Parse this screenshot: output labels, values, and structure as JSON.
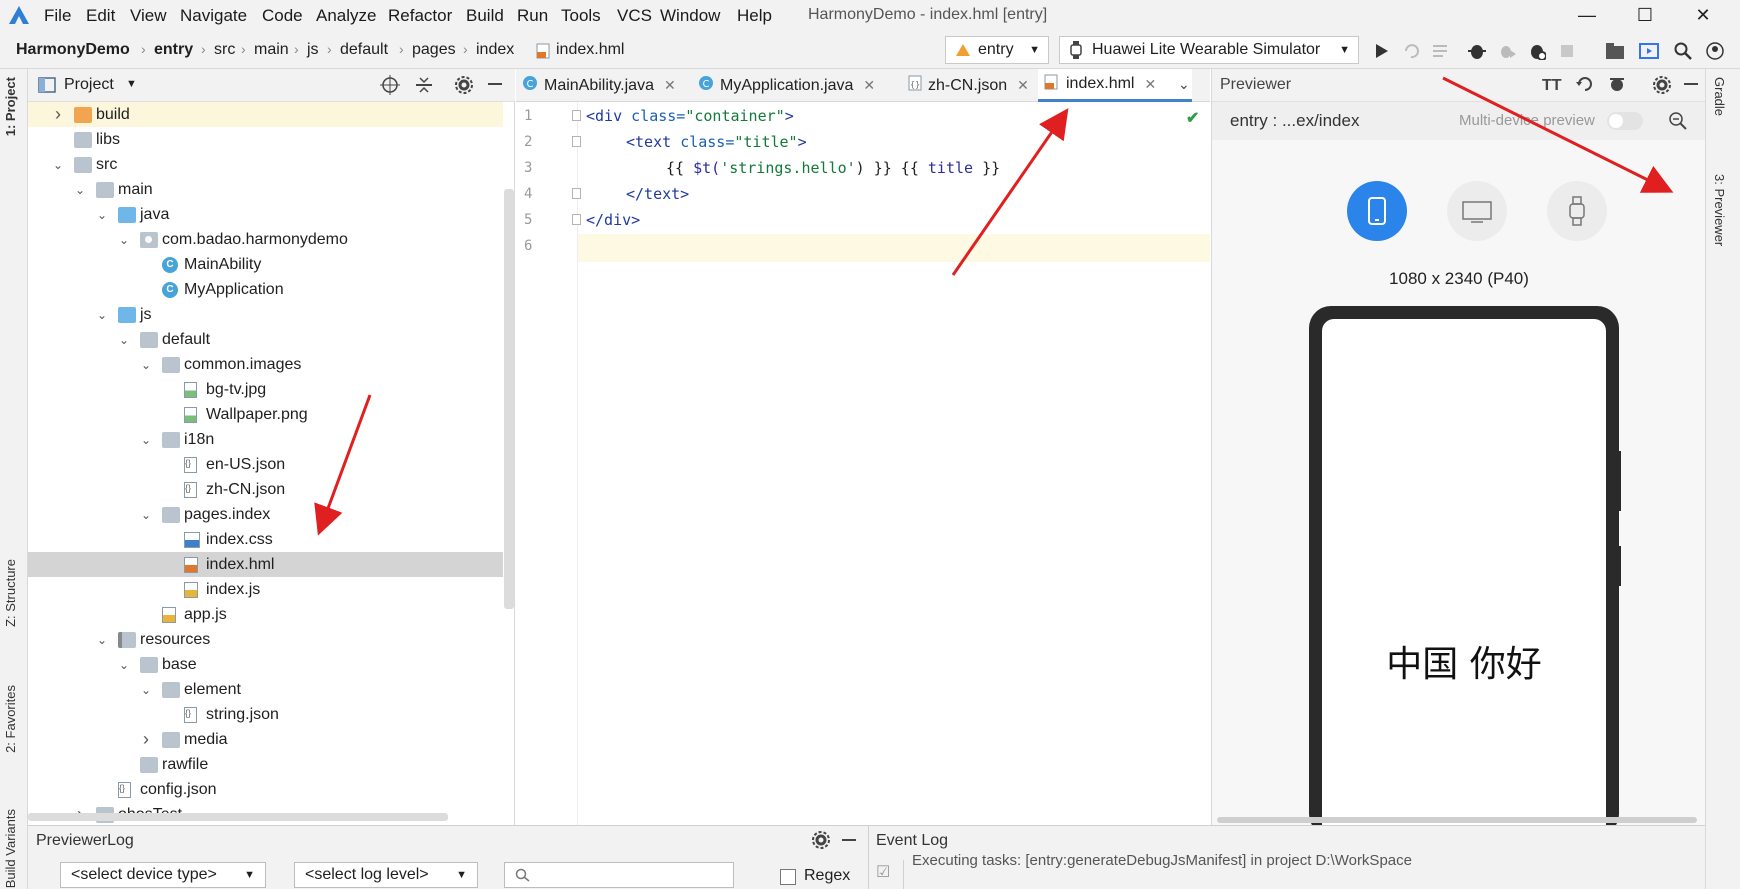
{
  "window": {
    "title": "HarmonyDemo - index.hml [entry]",
    "menu": [
      "File",
      "Edit",
      "View",
      "Navigate",
      "Code",
      "Analyze",
      "Refactor",
      "Build",
      "Run",
      "Tools",
      "VCS",
      "Window",
      "Help"
    ]
  },
  "breadcrumb": [
    "HarmonyDemo",
    "entry",
    "src",
    "main",
    "js",
    "default",
    "pages",
    "index",
    "index.hml"
  ],
  "toolbar": {
    "module": "entry",
    "device": "Huawei Lite Wearable Simulator"
  },
  "left_stripe": {
    "project": "1: Project",
    "structure": "Z: Structure",
    "favorites": "2: Favorites",
    "build_variants": "Build Variants"
  },
  "project_panel": {
    "title": "Project",
    "tree": [
      {
        "label": "build",
        "type": "folder-orange",
        "depth": 2,
        "expander": "collapsed",
        "selected": false,
        "highlight": true
      },
      {
        "label": "libs",
        "type": "folder",
        "depth": 2,
        "expander": "none"
      },
      {
        "label": "src",
        "type": "folder",
        "depth": 2,
        "expander": "expanded"
      },
      {
        "label": "main",
        "type": "folder",
        "depth": 3,
        "expander": "expanded"
      },
      {
        "label": "java",
        "type": "folder-blue",
        "depth": 4,
        "expander": "expanded"
      },
      {
        "label": "com.badao.harmonydemo",
        "type": "package",
        "depth": 5,
        "expander": "expanded"
      },
      {
        "label": "MainAbility",
        "type": "class",
        "depth": 6,
        "expander": "none"
      },
      {
        "label": "MyApplication",
        "type": "class",
        "depth": 6,
        "expander": "none"
      },
      {
        "label": "js",
        "type": "folder-blue",
        "depth": 4,
        "expander": "expanded"
      },
      {
        "label": "default",
        "type": "folder",
        "depth": 5,
        "expander": "expanded"
      },
      {
        "label": "common.images",
        "type": "folder",
        "depth": 6,
        "expander": "expanded"
      },
      {
        "label": "bg-tv.jpg",
        "type": "image",
        "depth": 7,
        "expander": "none"
      },
      {
        "label": "Wallpaper.png",
        "type": "image",
        "depth": 7,
        "expander": "none"
      },
      {
        "label": "i18n",
        "type": "folder",
        "depth": 6,
        "expander": "expanded"
      },
      {
        "label": "en-US.json",
        "type": "json",
        "depth": 7,
        "expander": "none"
      },
      {
        "label": "zh-CN.json",
        "type": "json",
        "depth": 7,
        "expander": "none"
      },
      {
        "label": "pages.index",
        "type": "folder",
        "depth": 6,
        "expander": "expanded"
      },
      {
        "label": "index.css",
        "type": "css",
        "depth": 7,
        "expander": "none"
      },
      {
        "label": "index.hml",
        "type": "hml",
        "depth": 7,
        "expander": "none",
        "selected": true
      },
      {
        "label": "index.js",
        "type": "js",
        "depth": 7,
        "expander": "none"
      },
      {
        "label": "app.js",
        "type": "js",
        "depth": 6,
        "expander": "none"
      },
      {
        "label": "resources",
        "type": "folder-res",
        "depth": 4,
        "expander": "expanded"
      },
      {
        "label": "base",
        "type": "folder",
        "depth": 5,
        "expander": "expanded"
      },
      {
        "label": "element",
        "type": "folder",
        "depth": 6,
        "expander": "expanded"
      },
      {
        "label": "string.json",
        "type": "json",
        "depth": 7,
        "expander": "none"
      },
      {
        "label": "media",
        "type": "folder",
        "depth": 6,
        "expander": "collapsed"
      },
      {
        "label": "rawfile",
        "type": "folder",
        "depth": 5,
        "expander": "none"
      },
      {
        "label": "config.json",
        "type": "json",
        "depth": 4,
        "expander": "none"
      },
      {
        "label": "ohosTest",
        "type": "folder",
        "depth": 3,
        "expander": "collapsed"
      }
    ]
  },
  "editor": {
    "tabs": [
      {
        "label": "MainAbility.java",
        "icon": "class",
        "active": false
      },
      {
        "label": "MyApplication.java",
        "icon": "class",
        "active": false
      },
      {
        "label": "zh-CN.json",
        "icon": "json",
        "active": false
      },
      {
        "label": "index.hml",
        "icon": "hml",
        "active": true
      }
    ],
    "line_numbers": [
      "1",
      "2",
      "3",
      "4",
      "5",
      "6"
    ],
    "code": {
      "l1_open": "<div ",
      "l1_attr": "class=",
      "l1_val": "\"container\"",
      "l1_close": ">",
      "l2_open": "<text ",
      "l2_attr": "class=",
      "l2_val": "\"title\"",
      "l2_close": ">",
      "l3_a": "{{ ",
      "l3_fn": "$t(",
      "l3_str": "'strings.hello'",
      "l3_b": ") }} {{ ",
      "l3_var": "title",
      "l3_c": " }}",
      "l4": "</text>",
      "l5": "</div>"
    }
  },
  "previewer": {
    "title": "Previewer",
    "path": "entry : ...ex/index",
    "multi_device": "Multi-device preview",
    "resolution": "1080 x 2340 (P40)",
    "screen_text": "中国 你好",
    "devices": [
      "phone-icon",
      "tv-icon",
      "watch-icon"
    ],
    "active_device": "phone"
  },
  "right_stripe": {
    "gradle": "Gradle",
    "previewer": "3: Previewer"
  },
  "bottom": {
    "previewer_log": "PreviewerLog",
    "device_type": "<select device type>",
    "log_level": "<select log level>",
    "search_placeholder": "",
    "regex": "Regex",
    "event_log": "Event Log",
    "event_text": "Executing tasks: [entry:generateDebugJsManifest] in project D:\\WorkSpace"
  },
  "colors": {
    "accent": "#3574f0",
    "arrow": "#e02020",
    "active_tab_underline": "#4083c9"
  }
}
